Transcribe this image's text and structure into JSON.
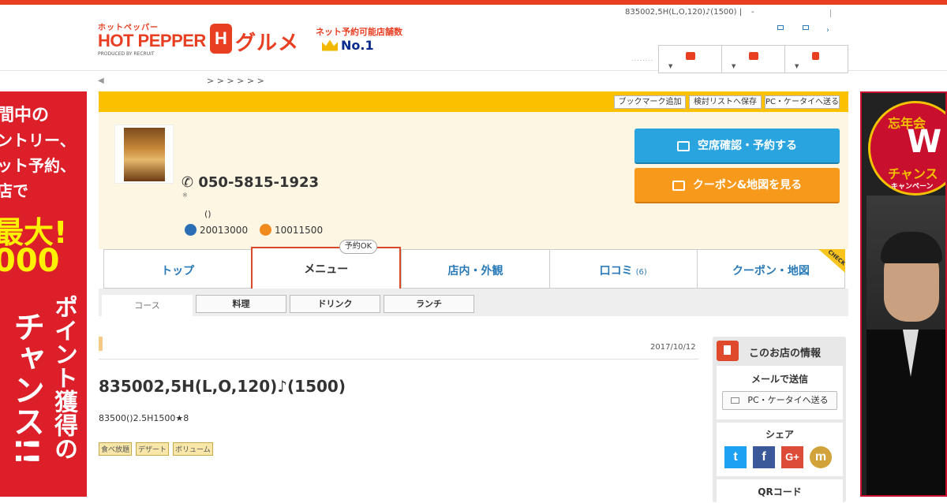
{
  "header": {
    "logo_kana": "ホットペッパー",
    "logo_main": "HOT PEPPER",
    "logo_produced": "PRODUCED BY RECRUIT",
    "logo_h": "H",
    "logo_gurume": "グルメ",
    "no1_text": "ネット予約可能店舗数",
    "no1_rank": "No.1",
    "top_right_text": "835002,5H(L,O,120)♪(1500) |",
    "top_right_dash": "-",
    "dots": "........",
    "chevron": "›"
  },
  "breadcrumb": {
    "back": "◀",
    "seps": "> >          > >       > >"
  },
  "left_ad": {
    "lines": [
      "間中の",
      "ントリー、",
      "ット予約、",
      "店で",
      "最大!",
      "000",
      "ポイ",
      "ント獲",
      "得の",
      "チャ",
      "ンス!!"
    ],
    "vertical": "ポイント獲得の",
    "vertical2": "チャンス!!"
  },
  "right_ad": {
    "badge_top": "忘年会",
    "badge_w": "W",
    "badge_mid": "チャンス",
    "badge_bot": "キャンペーン"
  },
  "shop": {
    "band_buttons": [
      "ブックマーク追加",
      "検討リストへ保存",
      "PC・ケータイへ送る"
    ],
    "phone": "050-5815-1923",
    "phone_icon": "✆",
    "phone_note": "※",
    "paren": "()",
    "hours_moon": "20013000",
    "hours_sun": "10011500",
    "reserve_button": "空席確認・予約する",
    "coupon_button": "クーポン&地図を見る"
  },
  "tabs": [
    {
      "label": "トップ"
    },
    {
      "label": "メニュー"
    },
    {
      "label": "店内・外観"
    },
    {
      "label": "口コミ",
      "count": "(6)"
    },
    {
      "label": "クーポン・地図"
    }
  ],
  "tab_badge": "予約OK",
  "check_label": "CHECK",
  "subtabs": [
    "コース",
    "料理",
    "ドリンク",
    "ランチ"
  ],
  "course": {
    "date": "2017/10/12",
    "title": "835002,5H(L,O,120)♪(1500)",
    "desc": "83500()2.5H1500★8",
    "tags": [
      "食べ放題",
      "デザート",
      "ボリューム"
    ]
  },
  "sidebar": {
    "title": "このお店の情報",
    "mail_label": "メールで送信",
    "mail_button": "PC・ケータイへ送る",
    "share_label": "シェア",
    "qr_label": "QRコード",
    "social": [
      {
        "name": "twitter",
        "glyph": "t",
        "color": "#1da1f2"
      },
      {
        "name": "facebook",
        "glyph": "f",
        "color": "#3b5998"
      },
      {
        "name": "google-plus",
        "glyph": "G+",
        "color": "#dd4b39"
      },
      {
        "name": "mixi",
        "glyph": "m",
        "color": "#d1a33a"
      }
    ]
  }
}
